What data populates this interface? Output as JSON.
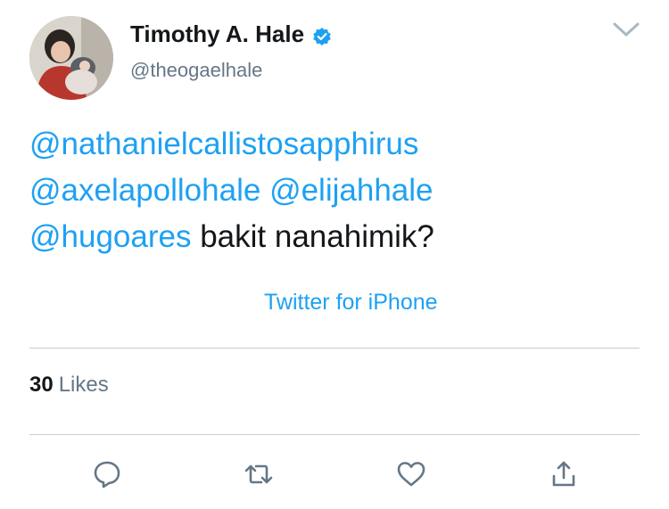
{
  "user": {
    "display_name": "Timothy A. Hale",
    "handle": "@theogaelhale",
    "verified": true
  },
  "tweet": {
    "mention_1": "@nathanielcallistosapphirus",
    "mention_2": "@axelapollohale",
    "mention_3": "@elijahhale",
    "mention_4": "@hugoares",
    "text": "bakit nanahimik?"
  },
  "source": "Twitter for iPhone",
  "stats": {
    "likes_count": "30",
    "likes_label": "Likes"
  },
  "actions": [
    "reply-icon",
    "retweet-icon",
    "like-icon",
    "share-icon"
  ],
  "colors": {
    "link": "#1da1f2",
    "secondary_text": "#657786",
    "primary_text": "#14171a",
    "divider": "#c6ccd1",
    "icon": "#657786"
  }
}
